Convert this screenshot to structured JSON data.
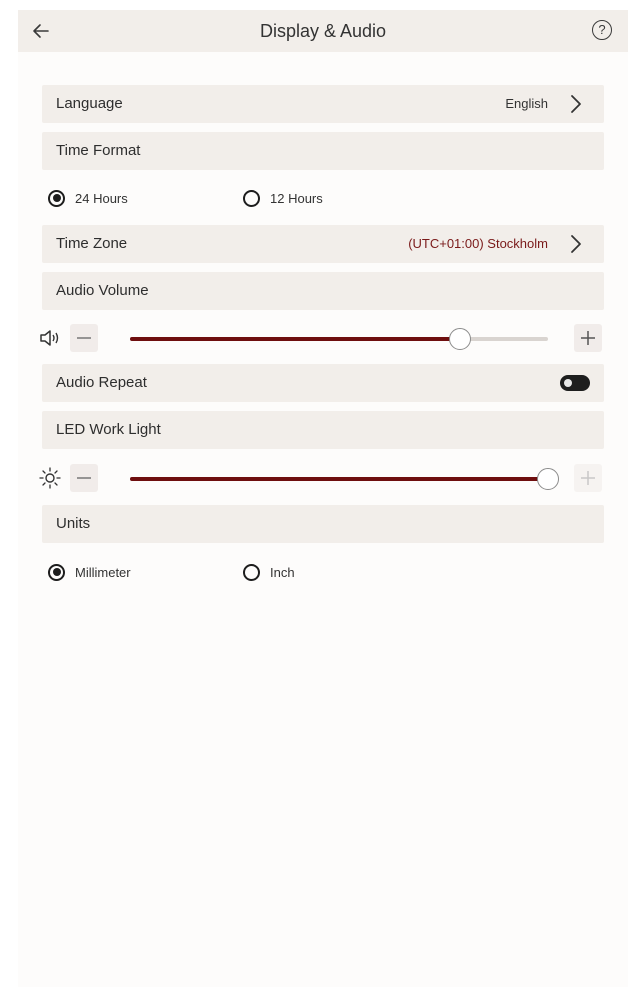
{
  "header": {
    "title": "Display & Audio",
    "back_icon": "arrow-left-icon",
    "help_icon": "question-circle-icon",
    "help_symbol": "?"
  },
  "language": {
    "label": "Language",
    "value": "English"
  },
  "time_format": {
    "label": "Time Format",
    "options": [
      {
        "label": "24 Hours",
        "selected": true
      },
      {
        "label": "12 Hours",
        "selected": false
      }
    ]
  },
  "time_zone": {
    "label": "Time Zone",
    "value": "(UTC+01:00) Stockholm"
  },
  "audio_volume": {
    "label": "Audio Volume",
    "level_fraction": 0.79
  },
  "audio_repeat": {
    "label": "Audio Repeat",
    "enabled": true
  },
  "led_work_light": {
    "label": "LED Work Light",
    "level_fraction": 1.0
  },
  "units": {
    "label": "Units",
    "options": [
      {
        "label": "Millimeter",
        "selected": true
      },
      {
        "label": "Inch",
        "selected": false
      }
    ]
  },
  "colors": {
    "accent": "#6e0e0e",
    "row_bg": "#f2eeea",
    "value_text": "#7a1a1a"
  }
}
